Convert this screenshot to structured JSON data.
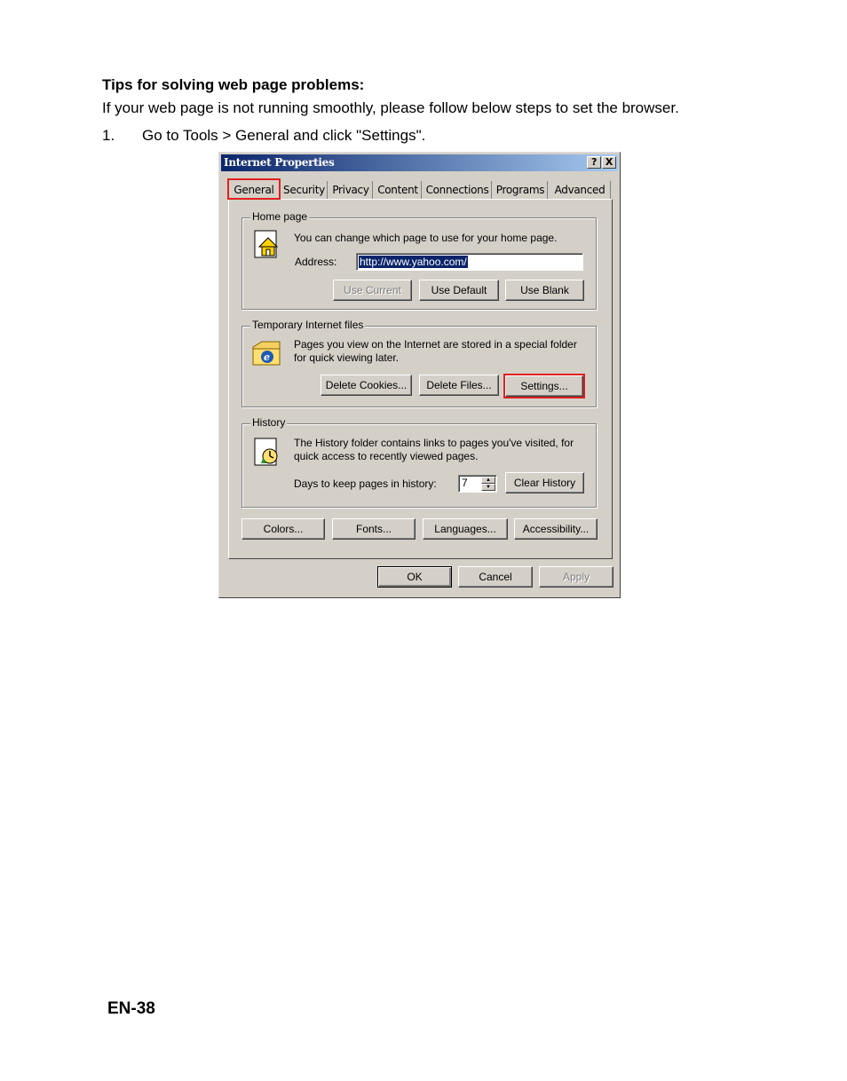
{
  "doc": {
    "heading": "Tips for solving web page problems:",
    "intro": "If your web page is not running smoothly, please follow below steps to set the browser.",
    "step_number": "1.",
    "step_text": "Go to Tools > General and click \"Settings\".",
    "page_number": "EN-38"
  },
  "dialog": {
    "title": "Internet Properties",
    "help_label": "?",
    "close_label": "X",
    "tabs": [
      "General",
      "Security",
      "Privacy",
      "Content",
      "Connections",
      "Programs",
      "Advanced"
    ],
    "active_tab": "General",
    "home_page": {
      "legend": "Home page",
      "description": "You can change which page to use for your home page.",
      "address_label": "Address:",
      "address_value": "http://www.yahoo.com/",
      "buttons": [
        "Use Current",
        "Use Default",
        "Use Blank"
      ]
    },
    "temp_files": {
      "legend": "Temporary Internet files",
      "description_line1": "Pages you view on the Internet are stored in a special folder",
      "description_line2": "for quick viewing later.",
      "buttons": [
        "Delete Cookies...",
        "Delete Files...",
        "Settings..."
      ]
    },
    "history": {
      "legend": "History",
      "description_line1": "The History folder contains links to pages you've visited, for",
      "description_line2": "quick access to recently viewed pages.",
      "days_label": "Days to keep pages in history:",
      "days_value": "7",
      "clear_button": "Clear History"
    },
    "bottom_buttons": [
      "Colors...",
      "Fonts...",
      "Languages...",
      "Accessibility..."
    ],
    "footer_buttons": [
      "OK",
      "Cancel",
      "Apply"
    ],
    "highlight_color": "#e02020",
    "title_color": "#0a246a"
  }
}
